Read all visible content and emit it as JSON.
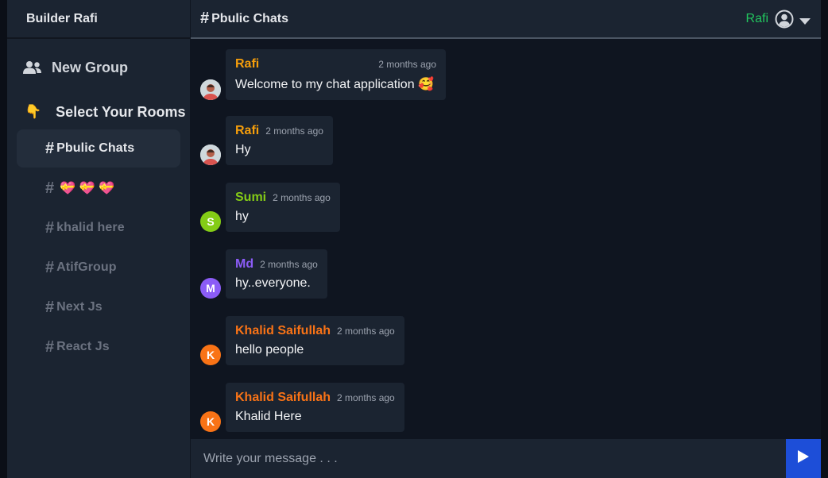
{
  "sidebar": {
    "brand": "Builder Rafi",
    "new_group": "New Group",
    "rooms_title": "Select Your Rooms",
    "rooms_emoji": "👇",
    "rooms": [
      {
        "name": "Pbulic Chats",
        "active": true
      },
      {
        "name": "💝 💝 💝",
        "active": false
      },
      {
        "name": "khalid here",
        "active": false
      },
      {
        "name": "AtifGroup",
        "active": false
      },
      {
        "name": "Next Js",
        "active": false
      },
      {
        "name": "React Js",
        "active": false
      }
    ]
  },
  "header": {
    "room_title": "Pbulic Chats",
    "user_name": "Rafi"
  },
  "messages": [
    {
      "author": "Rafi",
      "time": "2 months ago",
      "text": "Welcome to my chat application 🥰",
      "avatar": "photo",
      "color": "#f59e0b"
    },
    {
      "author": "Rafi",
      "time": "2 months ago",
      "text": "Hy",
      "avatar": "photo",
      "color": "#f59e0b"
    },
    {
      "author": "Sumi",
      "time": "2 months ago",
      "text": "hy",
      "avatar": "S",
      "color": "#84cc16"
    },
    {
      "author": "Md",
      "time": "2 months ago",
      "text": "hy..everyone.",
      "avatar": "M",
      "color": "#8b5cf6"
    },
    {
      "author": "Khalid Saifullah",
      "time": "2 months ago",
      "text": "hello people",
      "avatar": "K",
      "color": "#f97316"
    },
    {
      "author": "Khalid Saifullah",
      "time": "2 months ago",
      "text": "Khalid Here",
      "avatar": "K",
      "color": "#f97316"
    }
  ],
  "composer": {
    "placeholder": "Write your message . . ."
  },
  "colors": {
    "accent_send": "#1d4ed8",
    "user_name": "#22c55e"
  }
}
